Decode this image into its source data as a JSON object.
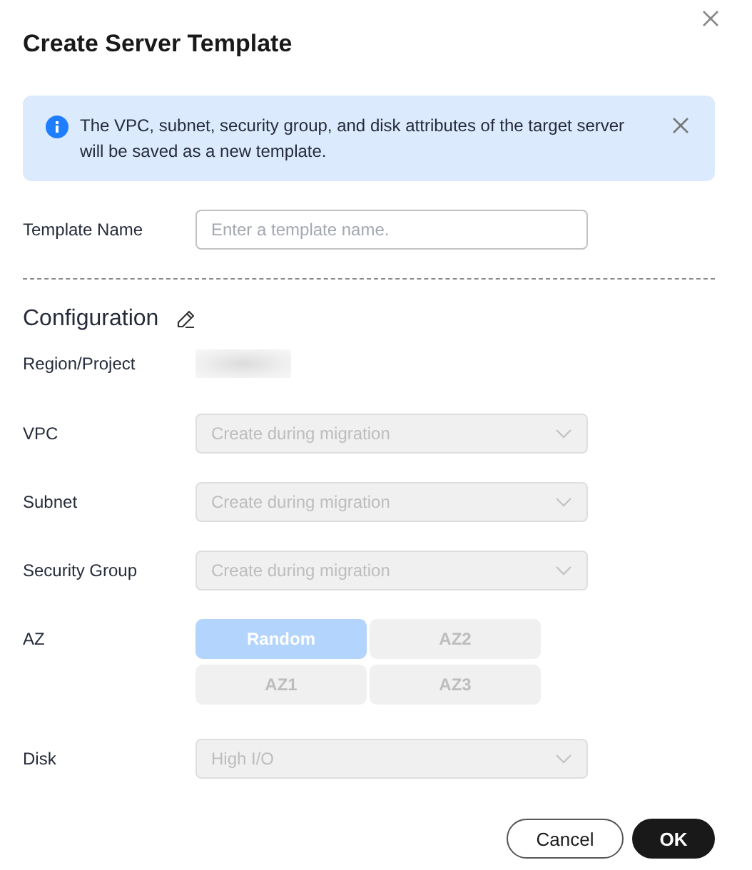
{
  "dialog": {
    "title": "Create Server Template"
  },
  "notice": {
    "text": "The VPC, subnet, security group, and disk attributes of the target server will be saved as a new template."
  },
  "template_name": {
    "label": "Template Name",
    "placeholder": "Enter a template name."
  },
  "configuration": {
    "heading": "Configuration"
  },
  "fields": [
    {
      "kind": "redacted",
      "label": "Region/Project"
    },
    {
      "kind": "select",
      "label": "VPC",
      "value": "Create during migration",
      "disabled": true
    },
    {
      "kind": "select",
      "label": "Subnet",
      "value": "Create during migration",
      "disabled": true
    },
    {
      "kind": "select",
      "label": "Security Group",
      "value": "Create during migration",
      "disabled": true
    },
    {
      "kind": "options",
      "label": "AZ",
      "disabled": true,
      "options": [
        {
          "label": "Random",
          "selected": true
        },
        {
          "label": "AZ2",
          "selected": false
        },
        {
          "label": "AZ1",
          "selected": false
        },
        {
          "label": "AZ3",
          "selected": false
        }
      ]
    },
    {
      "kind": "select",
      "label": "Disk",
      "value": "High I/O",
      "disabled": true
    }
  ],
  "buttons": [
    {
      "label": "Cancel",
      "kind": "secondary"
    },
    {
      "label": "OK",
      "kind": "primary"
    }
  ]
}
